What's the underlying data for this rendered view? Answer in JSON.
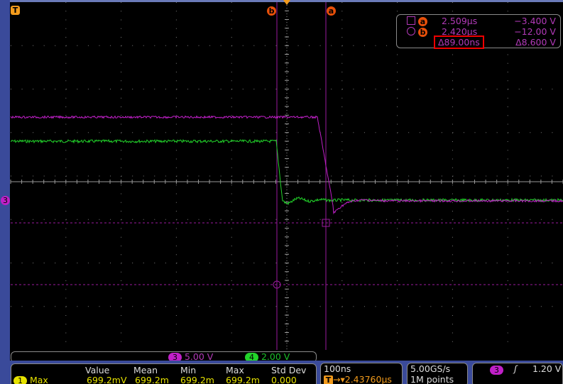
{
  "colors": {
    "ch3": "#c020c8",
    "ch4": "#22d42a",
    "ch1": "#e6e200",
    "cursor": "#9a1a9e",
    "grid": "#7a7a7a",
    "accent": "#f29b1c"
  },
  "markers": {
    "trigger_pos": "T",
    "cursor_a": "a",
    "cursor_b": "b",
    "ch3_level": "3"
  },
  "cursor_readout": {
    "a": {
      "icon": "square-icon",
      "label": "a",
      "time": "2.509µs",
      "volt": "−3.400 V"
    },
    "b": {
      "icon": "circle-icon",
      "label": "b",
      "time": "2.420µs",
      "volt": "−12.00 V"
    },
    "delta": {
      "time": "Δ89.00ns",
      "volt": "Δ8.600 V"
    }
  },
  "channels": [
    {
      "num": "3",
      "scale": "5.00 V"
    },
    {
      "num": "4",
      "scale": "2.00 V"
    }
  ],
  "measurements": {
    "headers": [
      "Value",
      "Mean",
      "Min",
      "Max",
      "Std Dev"
    ],
    "rows": [
      {
        "ch": "1",
        "name": "Max",
        "values": [
          "699.2mV",
          "699.2m",
          "699.2m",
          "699.2m",
          "0.000"
        ]
      }
    ]
  },
  "horizontal": {
    "scale": "100ns",
    "trigger_icon": "T",
    "delay": "2.43760µs"
  },
  "acquisition": {
    "rate": "5.00GS/s",
    "length": "1M points"
  },
  "trigger": {
    "source": "3",
    "slope_icon": "rising-edge-icon",
    "slope": "ʃ",
    "level": "1.20 V"
  }
}
